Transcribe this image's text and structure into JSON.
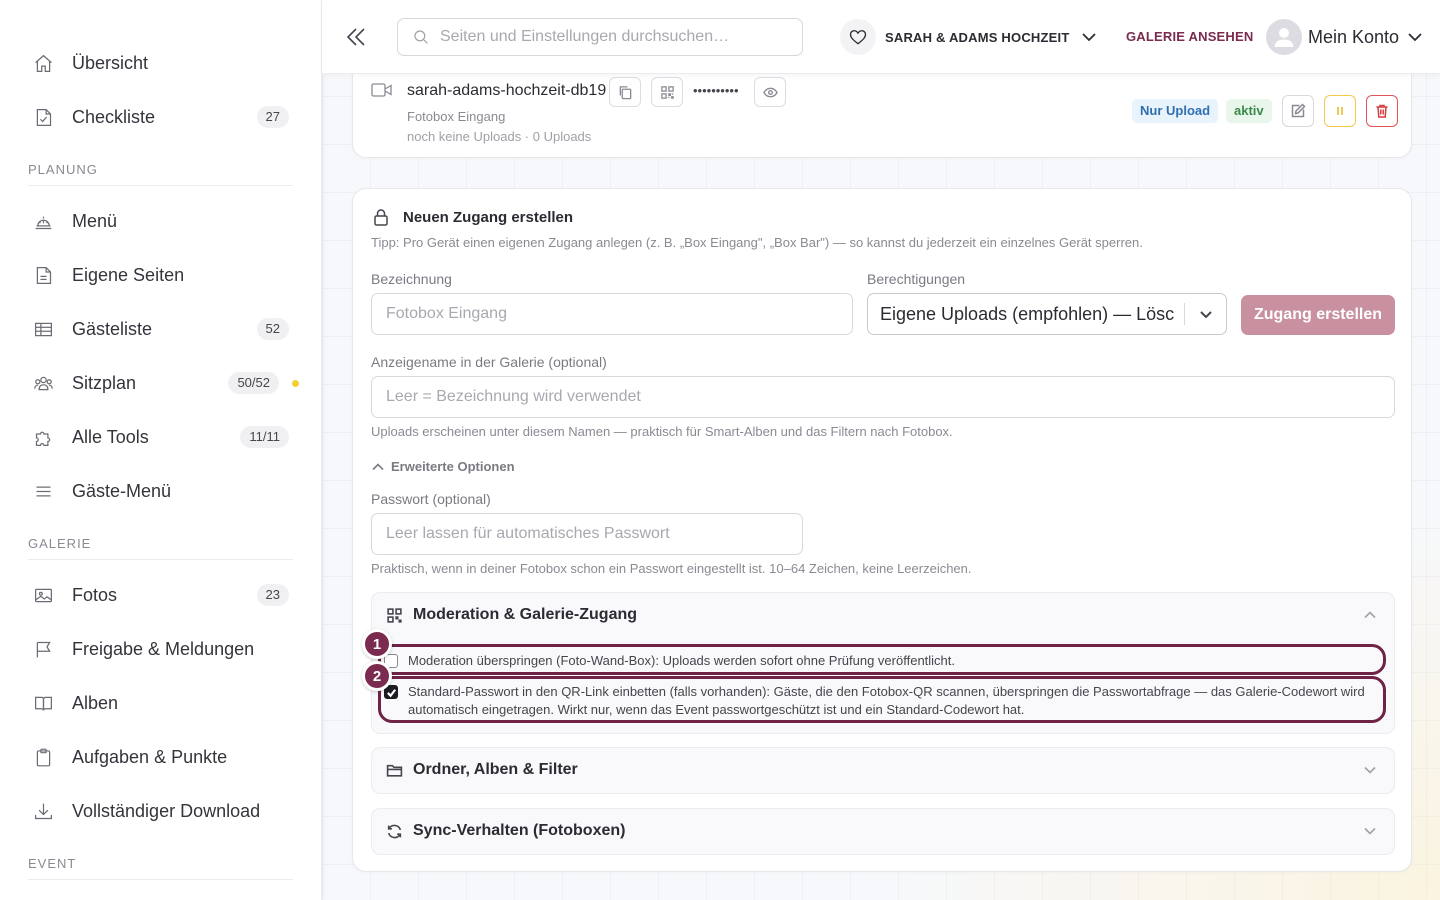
{
  "sidebar": {
    "items_top": [
      {
        "label": "Übersicht",
        "icon": "home-icon",
        "badge": ""
      },
      {
        "label": "Checkliste",
        "icon": "checklist-icon",
        "badge": "27"
      }
    ],
    "section_planung": "PLANUNG",
    "items_planung": [
      {
        "label": "Menü",
        "icon": "menu-cloche-icon",
        "badge": ""
      },
      {
        "label": "Eigene Seiten",
        "icon": "page-icon",
        "badge": ""
      },
      {
        "label": "Gästeliste",
        "icon": "table-icon",
        "badge": "52"
      },
      {
        "label": "Sitzplan",
        "icon": "people-icon",
        "badge": "50/52"
      },
      {
        "label": "Alle Tools",
        "icon": "puzzle-icon",
        "badge": "11/11"
      },
      {
        "label": "Gäste-Menü",
        "icon": "hamburger-icon",
        "badge": ""
      }
    ],
    "section_galerie": "GALERIE",
    "items_galerie": [
      {
        "label": "Fotos",
        "icon": "image-icon",
        "badge": "23"
      },
      {
        "label": "Freigabe & Meldungen",
        "icon": "flag-icon",
        "badge": ""
      },
      {
        "label": "Alben",
        "icon": "book-icon",
        "badge": ""
      },
      {
        "label": "Aufgaben & Punkte",
        "icon": "clipboard-icon",
        "badge": ""
      },
      {
        "label": "Vollständiger Download",
        "icon": "download-icon",
        "badge": ""
      }
    ],
    "section_event": "EVENT",
    "status_dot_color": "#f3cf33"
  },
  "header": {
    "search_placeholder": "Seiten und Einstellungen durchsuchen…",
    "event_name": "SARAH & ADAMS HOCHZEIT",
    "gallery_link": "GALERIE ANSEHEN",
    "account_label": "Mein Konto",
    "brand_color": "#7a2b4f"
  },
  "existing_access": {
    "name": "sarah-adams-hochzeit-db19",
    "password_mask": "••••••••••",
    "display_name": "Fotobox Eingang",
    "stats": "noch keine Uploads · 0 Uploads",
    "badge_mode": "Nur Upload",
    "badge_status": "aktiv"
  },
  "form": {
    "title": "Neuen Zugang erstellen",
    "tip": "Tipp: Pro Gerät einen eigenen Zugang anlegen (z. B. „Box Eingang\", „Box Bar\") — so kannst du jederzeit ein einzelnes Gerät sperren.",
    "label_name": "Bezeichnung",
    "placeholder_name": "Fotobox Eingang",
    "label_permissions": "Berechtigungen",
    "permissions_value": "Eigene Uploads (empfohlen) — Lösc",
    "create_button": "Zugang erstellen",
    "label_display": "Anzeigename in der Galerie (optional)",
    "placeholder_display": "Leer = Bezeichnung wird verwendet",
    "hint_display": "Uploads erscheinen unter diesem Namen — praktisch für Smart-Alben und das Filtern nach Fotobox.",
    "advanced_toggle": "Erweiterte Optionen",
    "label_password": "Passwort (optional)",
    "placeholder_password": "Leer lassen für automatisches Passwort",
    "hint_password": "Praktisch, wenn in deiner Fotobox schon ein Passwort eingestellt ist. 10–64 Zeichen, keine Leerzeichen."
  },
  "panels": {
    "moderation": {
      "title": "Moderation & Galerie-Zugang",
      "option1": "Moderation überspringen (Foto-Wand-Box): Uploads werden sofort ohne Prüfung veröffentlicht.",
      "option1_checked": false,
      "option2": "Standard-Passwort in den QR-Link einbetten (falls vorhanden): Gäste, die den Fotobox-QR scannen, überspringen die Passwortabfrage — das Galerie-Codewort wird automatisch eingetragen. Wirkt nur, wenn das Event passwortgeschützt ist und ein Standard-Codewort hat.",
      "option2_checked": true
    },
    "folders": {
      "title": "Ordner, Alben & Filter"
    },
    "sync": {
      "title": "Sync-Verhalten (Fotoboxen)"
    }
  },
  "annotations": {
    "marker1": "1",
    "marker2": "2",
    "color": "#6e2347"
  }
}
